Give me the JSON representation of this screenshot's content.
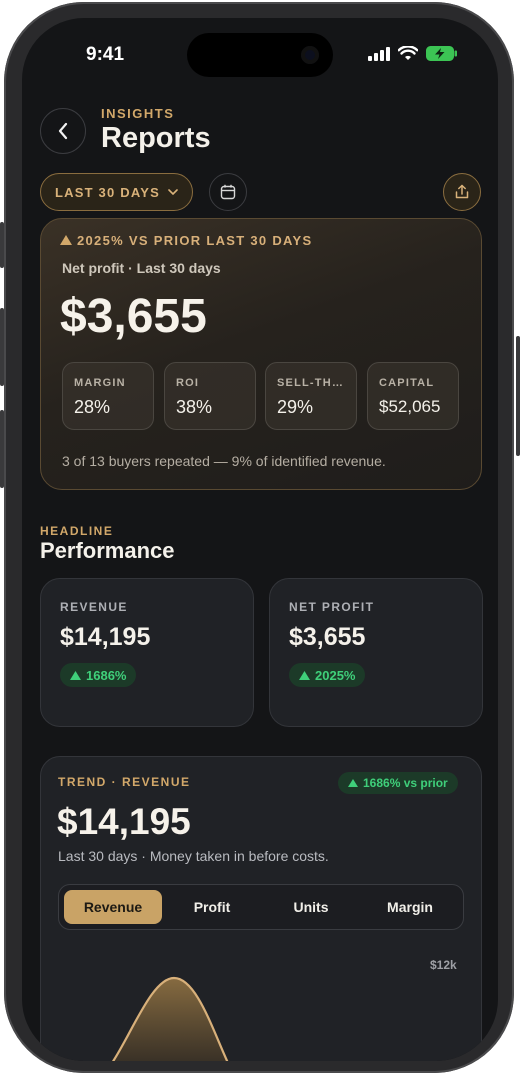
{
  "status_bar": {
    "time": "9:41"
  },
  "header": {
    "eyebrow": "INSIGHTS",
    "title": "Reports"
  },
  "toolbar": {
    "range_label": "LAST 30 DAYS"
  },
  "hero": {
    "trend_text": "2025% VS PRIOR LAST 30 DAYS",
    "subtitle": "Net profit · Last 30 days",
    "value": "$3,655",
    "metrics": [
      {
        "label": "MARGIN",
        "value": "28%"
      },
      {
        "label": "ROI",
        "value": "38%"
      },
      {
        "label": "SELL-TH…",
        "value": "29%"
      },
      {
        "label": "CAPITAL",
        "value": "$52,065"
      }
    ],
    "footnote": "3 of 13 buyers repeated — 9% of identified revenue."
  },
  "performance": {
    "eyebrow": "HEADLINE",
    "title": "Performance",
    "cards": [
      {
        "label": "REVENUE",
        "value": "$14,195",
        "change": "1686%"
      },
      {
        "label": "NET PROFIT",
        "value": "$3,655",
        "change": "2025%"
      }
    ]
  },
  "trend": {
    "eyebrow": "TREND · REVENUE",
    "badge": "1686% vs prior",
    "value": "$14,195",
    "subtitle": "Last 30 days · Money taken in before costs.",
    "tabs": [
      "Revenue",
      "Profit",
      "Units",
      "Margin"
    ],
    "selected_tab": "Revenue",
    "y_tick_top": "$12k"
  },
  "colors": {
    "accent": "#d2a86a",
    "positive": "#3fcf7a",
    "background": "#141517"
  }
}
